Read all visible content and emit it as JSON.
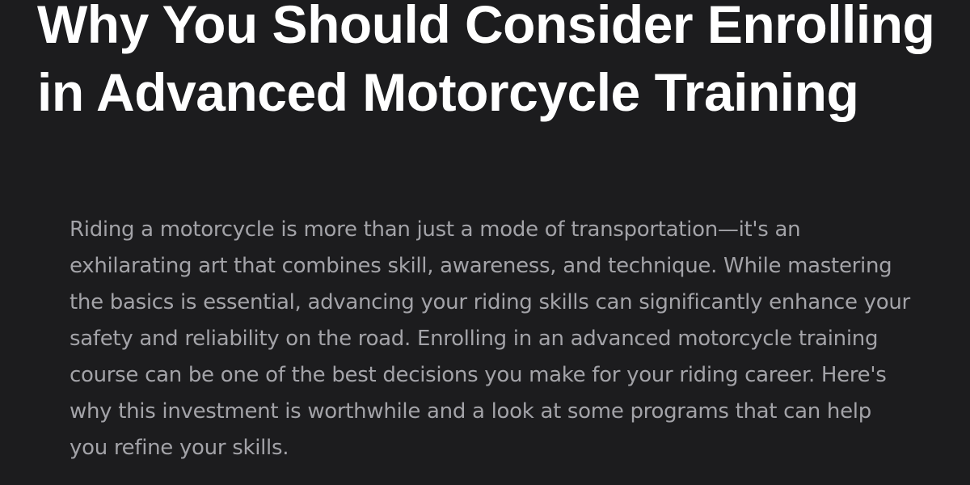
{
  "article": {
    "title": "Why You Should Consider Enrolling in Advanced Motorcycle Training",
    "intro": "Riding a motorcycle is more than just a mode of transportation—it's an exhilarating art that combines skill, awareness, and technique. While mastering the basics is essential, advancing your riding skills can significantly enhance your safety and reliability on the road. Enrolling in an advanced motorcycle training course can be one of the best decisions you make for your riding career. Here's why this investment is worthwhile and a look at some programs that can help you refine your skills."
  },
  "colors": {
    "background": "#1c1c1e",
    "title": "#ffffff",
    "body_text": "#a3a3a8"
  }
}
